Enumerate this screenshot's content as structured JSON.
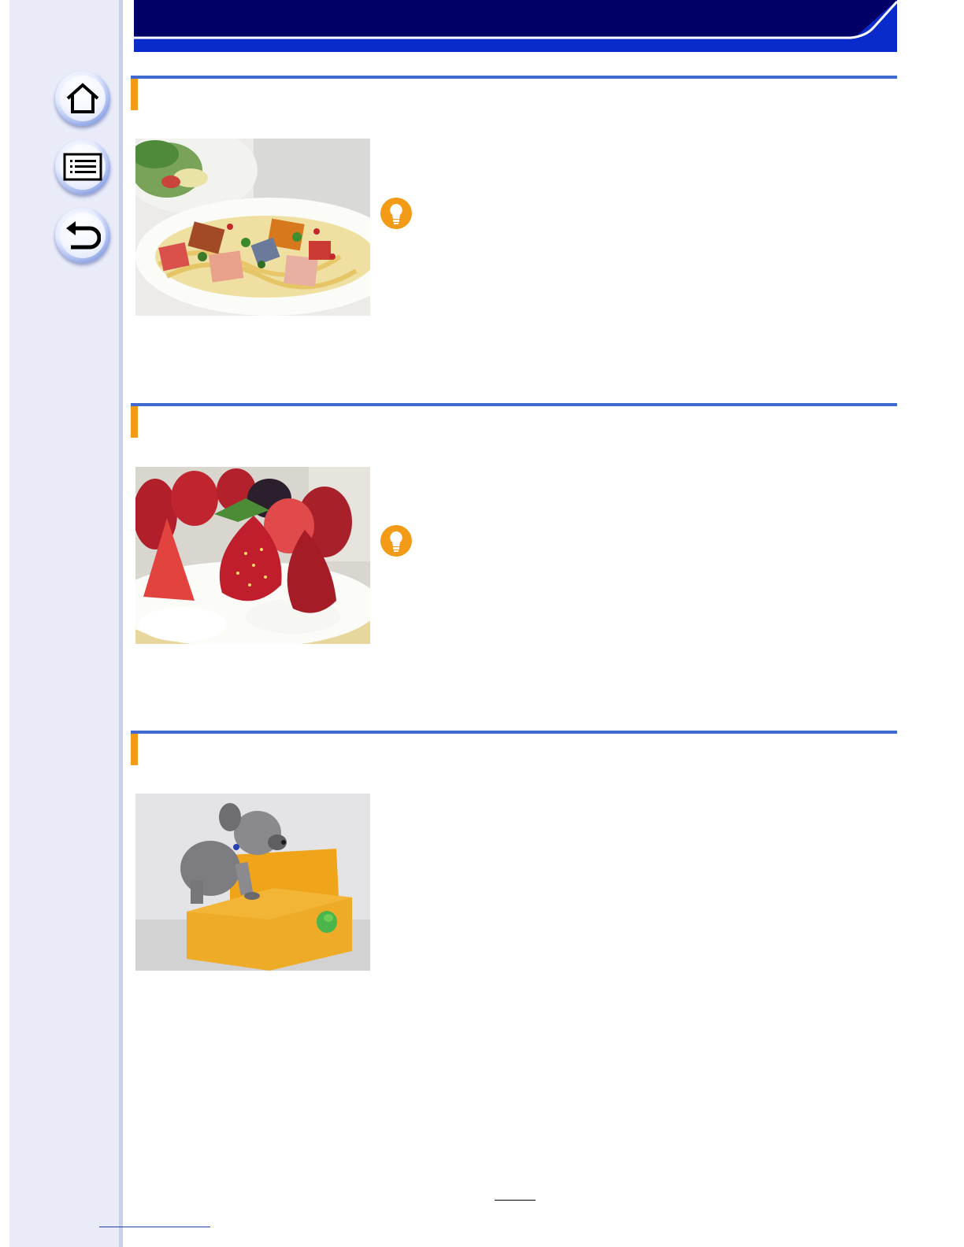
{
  "header": {
    "title": ""
  },
  "nav": {
    "home_icon": "home-icon",
    "contents_icon": "list-icon",
    "back_icon": "back-arrow-icon"
  },
  "sections": [
    {
      "title": "",
      "photo_subject": "pasta-dish",
      "has_tip": true
    },
    {
      "title": "",
      "photo_subject": "strawberry-cake",
      "has_tip": true
    },
    {
      "title": "",
      "photo_subject": "dog-on-sofa",
      "has_tip": false
    }
  ],
  "footer": {
    "page_number": "",
    "link_text": ""
  },
  "colors": {
    "header_navy": "#000066",
    "header_blue": "#0a2bcc",
    "section_line": "#3f6bd1",
    "accent_orange": "#f39a17",
    "sidebar_bg": "#e9ebf8"
  }
}
